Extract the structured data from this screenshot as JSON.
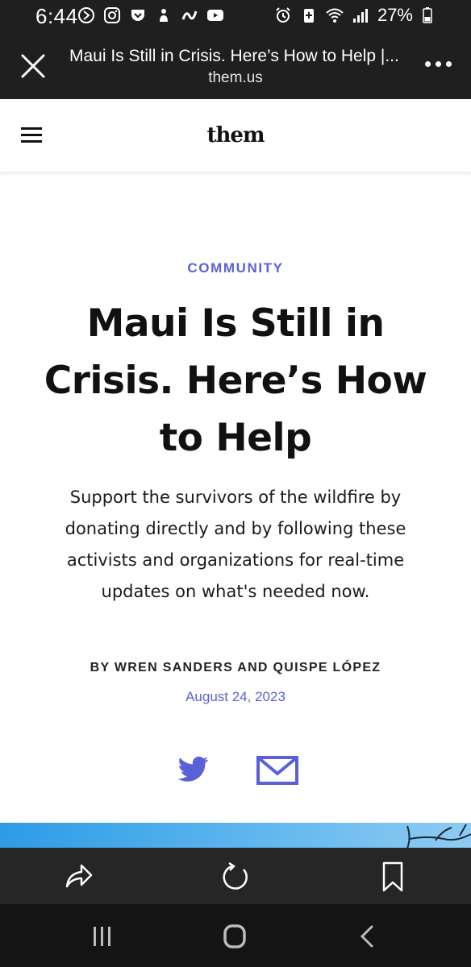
{
  "status_bar": {
    "time": "6:44",
    "battery": "27%",
    "left_icons": [
      "media-icon",
      "instagram-icon",
      "pocket-icon",
      "settings-icon",
      "app-icon",
      "youtube-icon"
    ],
    "right_icons": [
      "alarm-icon",
      "battery-saver-icon",
      "wifi-icon",
      "signal-icon",
      "battery-icon"
    ]
  },
  "browser": {
    "tab_title": "Maui Is Still in Crisis. Here’s How to Help |...",
    "url": "them.us"
  },
  "site": {
    "logo": "them"
  },
  "article": {
    "category": "COMMUNITY",
    "headline_lines": [
      "Maui Is Still in",
      "Crisis. Here’s How",
      "to Help"
    ],
    "dek_lines": [
      "Support the survivors of the wildfire by",
      "donating directly and by following these",
      "activists and organizations for real-time",
      "updates on what's needed now."
    ],
    "byline": "BY WREN SANDERS AND QUISPE LÓPEZ",
    "date": "August 24, 2023"
  },
  "colors": {
    "accent": "#5a61d6",
    "chrome": "#1f1f1f",
    "bottom_bar": "#262626",
    "nav_bar": "#141414"
  }
}
